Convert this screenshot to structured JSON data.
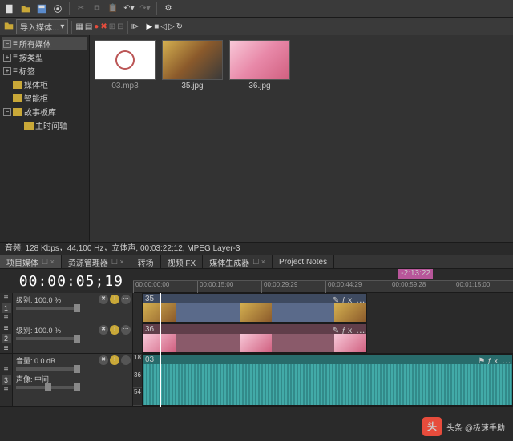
{
  "toolbar1": {
    "icons": [
      "new",
      "open",
      "save",
      "settings",
      "cut",
      "copy",
      "paste",
      "undo",
      "redo",
      "gear"
    ]
  },
  "toolbar2": {
    "import_label": "导入媒体...",
    "play_icons": [
      "home",
      "record",
      "play",
      "stop",
      "loop",
      "end"
    ]
  },
  "tree": [
    {
      "label": "所有媒体",
      "sel": true,
      "icon": "bar"
    },
    {
      "label": "按类型",
      "icon": "bar"
    },
    {
      "label": "标签",
      "icon": "bar"
    },
    {
      "label": "媒体柜",
      "icon": "fold"
    },
    {
      "label": "智能柜",
      "icon": "fold"
    },
    {
      "label": "故事板库",
      "icon": "fold",
      "exp": true
    },
    {
      "label": "主时间轴",
      "icon": "fold",
      "deep": true
    }
  ],
  "thumbs": [
    {
      "name": "03.mp3",
      "cls": "white"
    },
    {
      "name": "35.jpg",
      "cls": "i35"
    },
    {
      "name": "36.jpg",
      "cls": "i36"
    }
  ],
  "status": "音频: 128 Kbps，44,100 Hz，立体声, 00:03:22;12, MPEG Layer-3",
  "tabs": [
    {
      "label": "项目媒体",
      "x": true,
      "active": true
    },
    {
      "label": "资源管理器",
      "x": true
    },
    {
      "label": "转场"
    },
    {
      "label": "视频 FX"
    },
    {
      "label": "媒体生成器",
      "x": true
    },
    {
      "label": "Project Notes"
    }
  ],
  "timecode": "00:00:05;19",
  "ruler": [
    "00:00:00;00",
    "00:00:15;00",
    "00:00:29;29",
    "00:00:44;29",
    "00:00:59;28",
    "00:01:15;00"
  ],
  "marker": "-2:13:22",
  "tracks": {
    "v1": {
      "num": "1",
      "level": "级别: 100.0 %",
      "clip": "35",
      "fx": "✎ ƒｘ ⋯"
    },
    "v2": {
      "num": "2",
      "level": "级别: 100.0 %",
      "clip": "36",
      "fx": "✎ ƒｘ ⋯"
    },
    "a": {
      "num": "3",
      "vol": "音量:  0.0 dB",
      "pan": "声像:     中间",
      "clip": "03",
      "idx": [
        "18",
        "36",
        "54"
      ]
    }
  },
  "watermark": {
    "logo": "头",
    "text": "头条 @极速手助"
  }
}
